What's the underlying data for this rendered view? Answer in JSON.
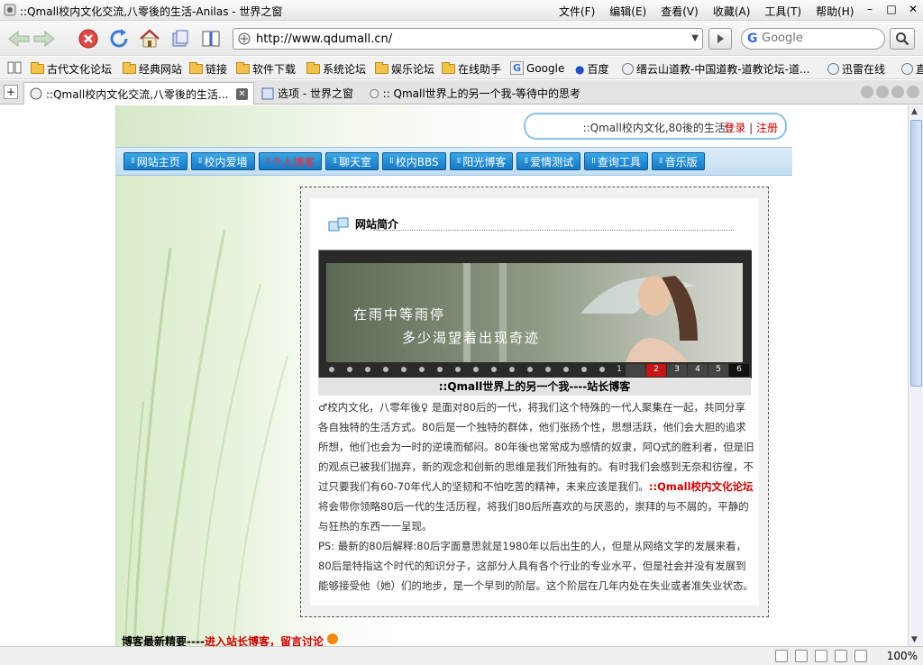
{
  "window": {
    "title": "::Qmall校内文化交流,八零後的生活-Anilas - 世界之窗",
    "menus": [
      "文件(F)",
      "编辑(E)",
      "查看(V)",
      "收藏(A)",
      "工具(T)",
      "帮助(H)"
    ]
  },
  "address": {
    "url": "http://www.qdumall.cn/"
  },
  "search": {
    "placeholder": "Google",
    "brand": "G"
  },
  "bookmarks": [
    "古代文化论坛",
    "经典网站",
    "链接",
    "软件下载",
    "系统论坛",
    "娱乐论坛",
    "在线助手",
    "Google",
    "百度",
    "缙云山道教-中国道教-道教论坛-道...",
    "迅雷在线",
    "直"
  ],
  "tabs": [
    {
      "label": "::Qmall校内文化交流,八零後的生活..."
    },
    {
      "label": "选项 - 世界之窗"
    },
    {
      "label": ":: Qmall世界上的另一个我-等待中的思考"
    }
  ],
  "page": {
    "login_text": "::Qmall校内文化,80後的生活::",
    "login": "登录",
    "sep": "|",
    "register": "注册",
    "nav": [
      "网站主页",
      "校内爱墙",
      "个人博客",
      "聊天室",
      "校内BBS",
      "阳光博客",
      "爱情测试",
      "查询工具",
      "音乐版"
    ],
    "panel_title": "网站简介",
    "banner_text1": "在雨中等雨停",
    "banner_text2": "多少渴望着出现奇迹",
    "banner_pages": [
      "1",
      "2",
      "3",
      "4",
      "5",
      "6"
    ],
    "caption": "::Qmall世界上的另一个我----站长博客",
    "para1_a": "♂校内文化，八零年後♀ 是面对80后的一代，将我们这个特殊的一代人聚集在一起，共同分享各自独特的生活方式。80后是一个独特的群体，他们张扬个性，思想活跃，他们会大胆的追求所想，他们也会为一时的逆境而郁闷。80年後也常常成为感情的奴隶，阿Q式的胜利者，但是旧的观点已被我们抛弃，新的观念和创新的思维是我们所独有的。有时我们会感到无奈和彷徨，不过只要我们有60-70年代人的坚韧和不怕吃苦的精神，未来应该是我们。",
    "para1_red": "::Qmall校内文化论坛",
    "para1_b": "将会带你领略80后一代的生活历程，将我们80后所喜欢的与厌恶的，崇拜的与不屑的，平静的与狂热的东西一一呈现。",
    "para2": "PS: 最新的80后解释:80后字面意思就是1980年以后出生的人，但是从网络文学的发展来看，80后是特指这个时代的知识分子，这部分人具有各个行业的专业水平，但是社会并没有发展到能够接受他（她）们的地步，是一个早到的阶层。这个阶层在几年内处在失业或者准失业状态。",
    "lower_a": "博客最新精要----",
    "lower_b": "进入站长博客，留言讨论"
  },
  "status": {
    "zoom": "100%"
  },
  "colors": {
    "accent": "#1677c4",
    "link_red": "#cc0000"
  }
}
